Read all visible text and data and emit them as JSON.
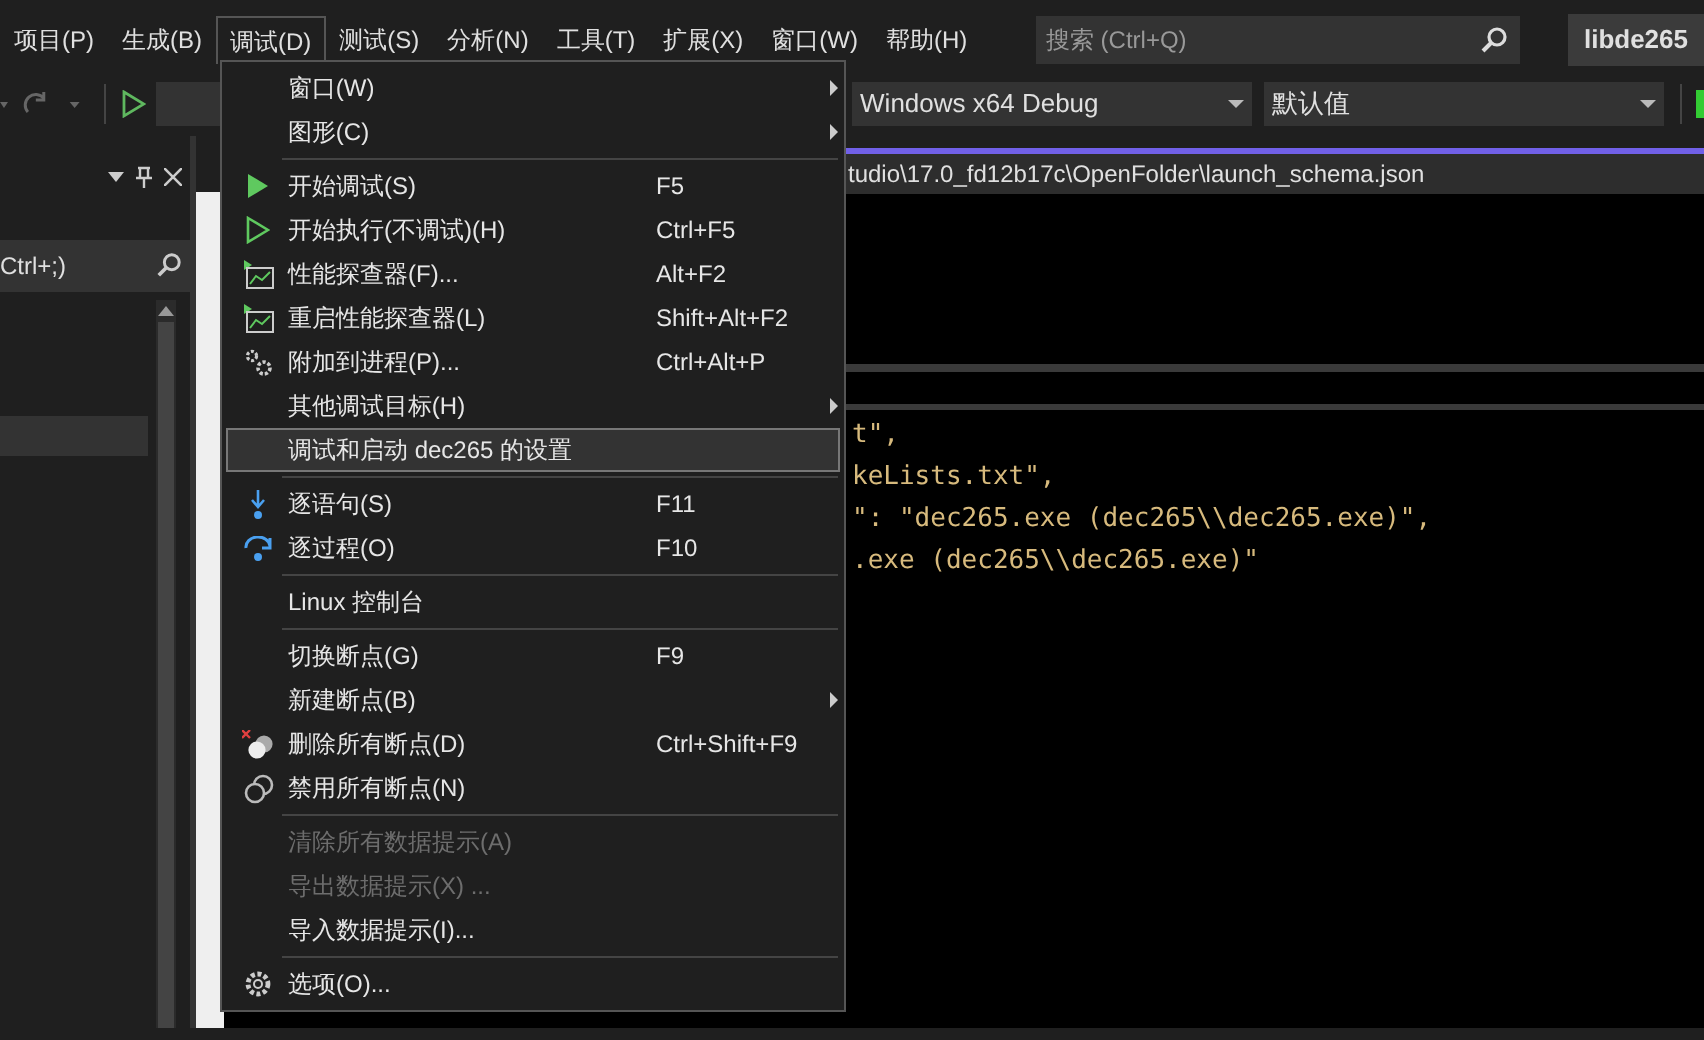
{
  "menubar": [
    {
      "label": "项目(P)",
      "selected": false
    },
    {
      "label": "生成(B)",
      "selected": false
    },
    {
      "label": "调试(D)",
      "selected": true
    },
    {
      "label": "测试(S)",
      "selected": false
    },
    {
      "label": "分析(N)",
      "selected": false
    },
    {
      "label": "工具(T)",
      "selected": false
    },
    {
      "label": "扩展(X)",
      "selected": false
    },
    {
      "label": "窗口(W)",
      "selected": false
    },
    {
      "label": "帮助(H)",
      "selected": false
    }
  ],
  "search": {
    "placeholder": "搜索 (Ctrl+Q)"
  },
  "solution_name": "libde265",
  "toolbar": {
    "combos": [
      "Windows x64 Debug",
      "默认值"
    ]
  },
  "side_panel": {
    "search_text": "Ctrl+;)"
  },
  "editor": {
    "file_path": "tudio\\17.0_fd12b17c\\OpenFolder\\launch_schema.json",
    "code_lines": [
      "t\",",
      "keLists.txt\",",
      "\": \"dec265.exe (dec265\\\\dec265.exe)\",",
      ".exe (dec265\\\\dec265.exe)\""
    ]
  },
  "debug_menu": [
    {
      "kind": "item",
      "label": "窗口(W)",
      "submenu": true,
      "disabled": false,
      "selected": false
    },
    {
      "kind": "item",
      "label": "图形(C)",
      "submenu": true,
      "disabled": false,
      "selected": false
    },
    {
      "kind": "separator"
    },
    {
      "kind": "play",
      "label": "开始调试(S)",
      "shortcut": "F5",
      "submenu": false,
      "disabled": false,
      "selected": false
    },
    {
      "kind": "playoutline",
      "label": "开始执行(不调试)(H)",
      "shortcut": "Ctrl+F5",
      "submenu": false,
      "disabled": false,
      "selected": false
    },
    {
      "kind": "profiler",
      "label": "性能探查器(F)...",
      "shortcut": "Alt+F2",
      "submenu": false,
      "disabled": false,
      "selected": false
    },
    {
      "kind": "profiler",
      "label": "重启性能探查器(L)",
      "shortcut": "Shift+Alt+F2",
      "submenu": false,
      "disabled": false,
      "selected": false
    },
    {
      "kind": "attach",
      "label": "附加到进程(P)...",
      "shortcut": "Ctrl+Alt+P",
      "submenu": false,
      "disabled": false,
      "selected": false
    },
    {
      "kind": "item",
      "label": "其他调试目标(H)",
      "submenu": true,
      "disabled": false,
      "selected": false
    },
    {
      "kind": "item",
      "label": "调试和启动 dec265 的设置",
      "submenu": false,
      "disabled": false,
      "selected": true
    },
    {
      "kind": "separator"
    },
    {
      "kind": "stepinto",
      "label": "逐语句(S)",
      "shortcut": "F11",
      "submenu": false,
      "disabled": false,
      "selected": false
    },
    {
      "kind": "stepover",
      "label": "逐过程(O)",
      "shortcut": "F10",
      "submenu": false,
      "disabled": false,
      "selected": false
    },
    {
      "kind": "separator"
    },
    {
      "kind": "item",
      "label": "Linux 控制台",
      "submenu": false,
      "disabled": false,
      "selected": false
    },
    {
      "kind": "separator"
    },
    {
      "kind": "item",
      "label": "切换断点(G)",
      "shortcut": "F9",
      "submenu": false,
      "disabled": false,
      "selected": false
    },
    {
      "kind": "item",
      "label": "新建断点(B)",
      "submenu": true,
      "disabled": false,
      "selected": false
    },
    {
      "kind": "deletebreakpoints",
      "label": "删除所有断点(D)",
      "shortcut": "Ctrl+Shift+F9",
      "submenu": false,
      "disabled": false,
      "selected": false
    },
    {
      "kind": "disablebreakpoints",
      "label": "禁用所有断点(N)",
      "submenu": false,
      "disabled": false,
      "selected": false
    },
    {
      "kind": "separator"
    },
    {
      "kind": "item",
      "label": "清除所有数据提示(A)",
      "submenu": false,
      "disabled": true,
      "selected": false
    },
    {
      "kind": "item",
      "label": "导出数据提示(X) ...",
      "submenu": false,
      "disabled": true,
      "selected": false
    },
    {
      "kind": "item",
      "label": "导入数据提示(I)...",
      "submenu": false,
      "disabled": false,
      "selected": false
    },
    {
      "kind": "separator"
    },
    {
      "kind": "options",
      "label": "选项(O)...",
      "submenu": false,
      "disabled": false,
      "selected": false
    }
  ]
}
